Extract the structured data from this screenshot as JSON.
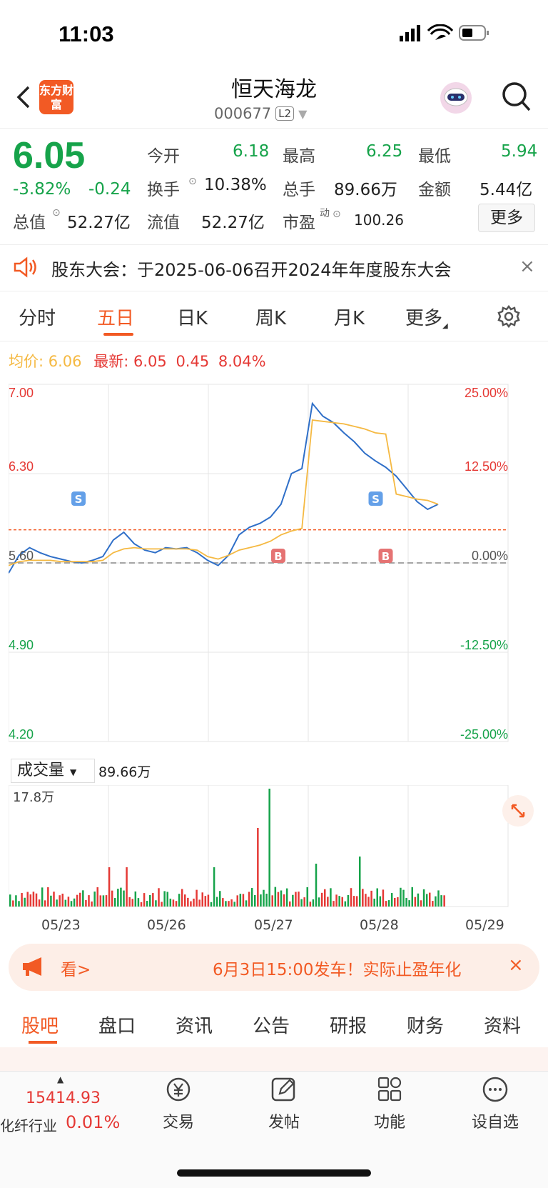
{
  "status": {
    "time": "11:03"
  },
  "header": {
    "title": "恒天海龙",
    "code": "000677",
    "level": "L2",
    "logo_text": "东方财富"
  },
  "quote": {
    "price": "6.05",
    "change_pct": "-3.82%",
    "change": "-0.24",
    "open_label": "今开",
    "open": "6.18",
    "high_label": "最高",
    "high": "6.25",
    "low_label": "最低",
    "low": "5.94",
    "turnover_label": "换手",
    "turnover": "10.38%",
    "volume_label": "总手",
    "volume": "89.66万",
    "amount_label": "金额",
    "amount": "5.44亿",
    "mktcap_label": "总值",
    "mktcap": "52.27亿",
    "float_label": "流值",
    "float": "52.27亿",
    "pe_label": "市盈",
    "pe_sup": "动",
    "pe": "100.26",
    "more": "更多"
  },
  "notice": {
    "text": "股东大会：于2025-06-06召开2024年年度股东大会",
    "close": "×"
  },
  "tabs": [
    "分时",
    "五日",
    "日K",
    "周K",
    "月K",
    "更多"
  ],
  "chart_info": {
    "avg_label": "均价:",
    "avg": "6.06",
    "latest_label": "最新:",
    "latest": "6.05",
    "latest_chg": "0.45",
    "latest_pct": "8.04%"
  },
  "chart_data": {
    "type": "line",
    "y_left_ticks": [
      "7.00",
      "6.30",
      "5.60",
      "4.90",
      "4.20"
    ],
    "y_right_ticks": [
      "25.00%",
      "12.50%",
      "0.00%",
      "-12.50%",
      "-25.00%"
    ],
    "ylim": [
      4.2,
      7.0
    ],
    "dates": [
      "05/23",
      "05/26",
      "05/27",
      "05/28",
      "05/29"
    ],
    "series": [
      {
        "values": [
          5.52,
          5.66,
          5.72,
          5.68,
          5.65,
          5.63,
          5.61,
          5.6,
          5.62,
          5.65,
          5.78,
          5.84,
          5.75,
          5.7,
          5.68,
          5.72,
          5.71,
          5.72,
          5.68,
          5.62,
          5.58,
          5.66,
          5.82,
          5.88,
          5.91,
          5.96,
          6.06,
          6.3,
          6.34,
          6.85,
          6.75,
          6.7,
          6.62,
          6.55,
          6.46,
          6.4,
          6.35,
          6.28,
          6.18,
          6.08,
          6.02,
          6.06
        ]
      },
      {
        "values": [
          5.58,
          5.61,
          5.62,
          5.62,
          5.62,
          5.61,
          5.61,
          5.61,
          5.61,
          5.62,
          5.68,
          5.71,
          5.72,
          5.71,
          5.71,
          5.71,
          5.71,
          5.71,
          5.7,
          5.65,
          5.63,
          5.66,
          5.7,
          5.72,
          5.74,
          5.77,
          5.82,
          5.85,
          5.87,
          6.72,
          6.71,
          6.7,
          6.69,
          6.67,
          6.65,
          6.62,
          6.61,
          6.14,
          6.12,
          6.1,
          6.09,
          6.06
        ]
      }
    ],
    "markers": [
      {
        "label": "S",
        "x": 0.14
      },
      {
        "label": "B",
        "x": 0.54
      },
      {
        "label": "S",
        "x": 0.735
      },
      {
        "label": "B",
        "x": 0.755
      }
    ]
  },
  "volume": {
    "label": "成交量",
    "total": "89.66万",
    "max": "17.8万"
  },
  "promo": {
    "see": "看>",
    "text": "6月3日15:00发车！实际止盈年化",
    "close": "×"
  },
  "bottom_tabs": [
    "股吧",
    "盘口",
    "资讯",
    "公告",
    "研报",
    "财务",
    "资料"
  ],
  "index": {
    "value": "15414.93",
    "name": "化纤行业",
    "change": "0.01%"
  },
  "nav": [
    {
      "label": "交易",
      "icon": "yen-icon"
    },
    {
      "label": "发帖",
      "icon": "edit-icon"
    },
    {
      "label": "功能",
      "icon": "grid-icon"
    },
    {
      "label": "设自选",
      "icon": "more-icon"
    }
  ],
  "colors": {
    "up": "#e53935",
    "down": "#16a34a",
    "accent": "#f25a24",
    "price_line": "#2f6fc8",
    "avg_line": "#f5b942"
  }
}
